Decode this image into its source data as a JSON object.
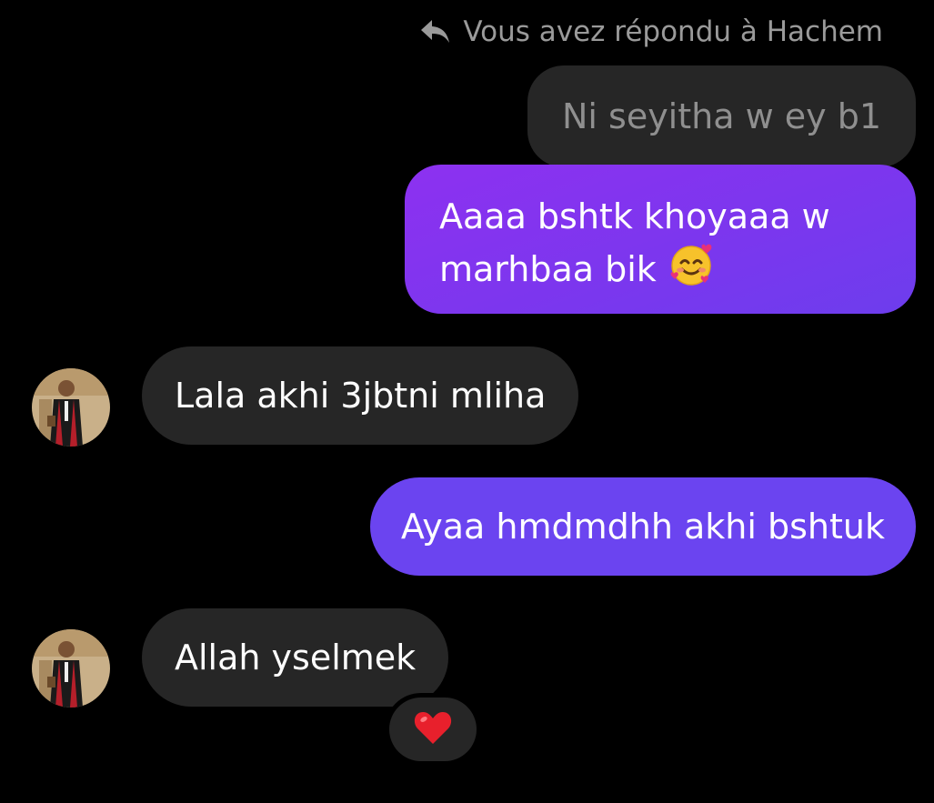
{
  "conversation": {
    "reply_header": "Vous avez répondu à Hachem",
    "quoted_message": "Ni seyitha w ey b1",
    "messages": [
      {
        "direction": "sent",
        "text": "Aaaa bshtk khoyaaa w marhbaa bik",
        "emoji": "smiling-face-with-hearts-icon"
      },
      {
        "direction": "received",
        "text": "Lala akhi 3jbtni mliha"
      },
      {
        "direction": "sent",
        "text": "Ayaa hmdmdhh akhi bshtuk"
      },
      {
        "direction": "received",
        "text": "Allah yselmek",
        "reaction": "red-heart-icon"
      }
    ]
  },
  "colors": {
    "background": "#000000",
    "received_bubble": "#262626",
    "sent_bubble_gradient_start": "#8d31f0",
    "sent_bubble_gradient_end": "#6b44f0",
    "reply_text": "#9a9a9a"
  }
}
